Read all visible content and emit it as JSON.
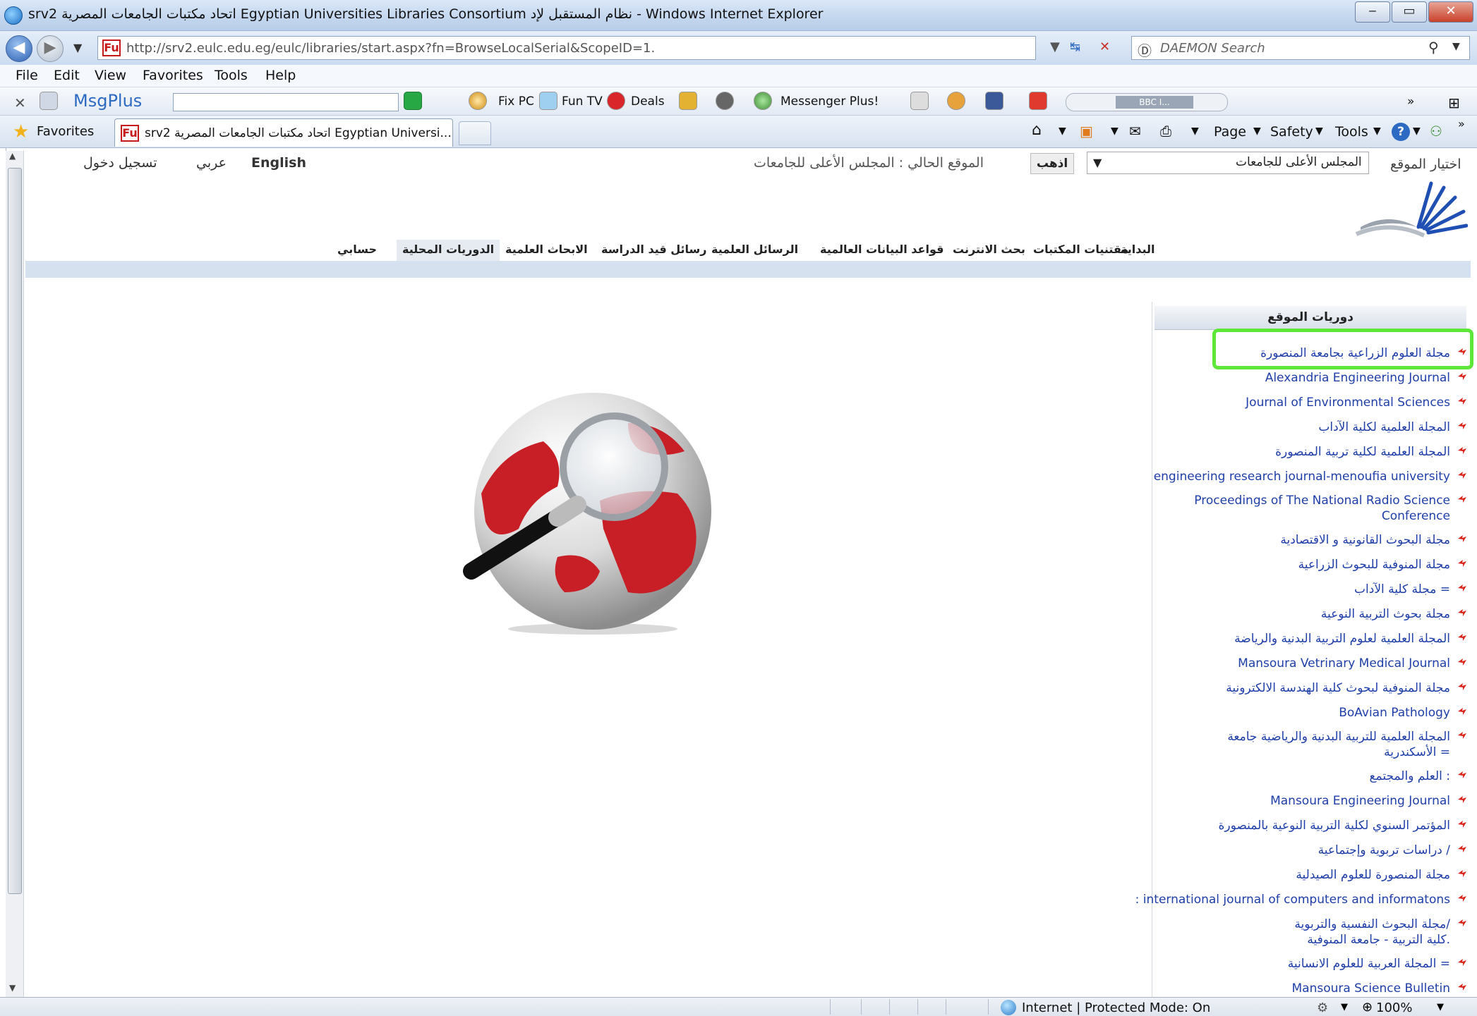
{
  "window": {
    "title": "srv2 اتحاد مكتبات الجامعات المصرية Egyptian Universities Libraries Consortium نظام المستقبل لإد - Windows Internet Explorer",
    "minimize": "‒",
    "maximize": "▭",
    "close": "✕"
  },
  "address": {
    "url": "http://srv2.eulc.edu.eg/eulc/libraries/start.aspx?fn=BrowseLocalSerial&ScopeID=1.",
    "fu_badge": "Fu",
    "search_placeholder": "DAEMON Search"
  },
  "menu": [
    "File",
    "Edit",
    "View",
    "Favorites",
    "Tools",
    "Help"
  ],
  "toolbar": {
    "msgplus": "MsgPlus",
    "fixpc": "Fix PC",
    "funtv": "Fun TV",
    "deals": "Deals",
    "messenger": "Messenger Plus!",
    "radio": "BBC I...",
    "overflow": "»"
  },
  "favorites": {
    "label": "Favorites",
    "tab_title": "srv2 اتحاد مكتبات الجامعات المصرية Egyptian Universi...",
    "page": "Page",
    "safety": "Safety",
    "tools": "Tools"
  },
  "site": {
    "lang_en": "English",
    "lang_ar": "عربي",
    "login": "تسجيل دخول",
    "current_location": "الموقع الحالي : المجلس الأعلى للجامعات",
    "go": "اذهب",
    "site_select_value": "المجلس الأعلى للجامعات",
    "site_select_label": "اختيار الموقع",
    "nav": [
      "البداية",
      "مقتنيات المكتبات",
      "بحث الانترنت",
      "قواعد البيانات العالمية",
      "الرسائل العلمية",
      "رسائل قيد الدراسة",
      "الابحاث العلمية",
      "الدوريات المحلية",
      "حسابي"
    ]
  },
  "panel": {
    "title": "دوريات الموقع",
    "journals": [
      "مجلة العلوم الزراعية بجامعة المنصورة",
      "Alexandria Engineering Journal",
      "Journal of Environmental Sciences",
      "المجلة العلمية لكلية الآداب",
      "المجلة العلمية لكلية تربية المنصورة",
      "engineering research journal-menoufia university",
      "Proceedings of The National Radio Science",
      "Conference",
      "مجلة البحوث القانونية و الاقتصادية",
      "مجلة المنوفية للبحوث الزراعية",
      "مجلة كلية الآداب =",
      "مجلة بحوث التربية النوعية",
      "المجلة العلمية لعلوم التربية البدنية والرياضة",
      "Mansoura Vetrinary Medical Journal",
      "مجلة المنوفية لبحوث كلية الهندسة الالكترونية",
      "BoAvian Pathology",
      "المجلة العلمية للتربية البدنية والرياضية جامعة",
      "الأسكندرية =",
      "العلم والمجتمع :",
      "Mansoura Engineering Journal",
      "المؤتمر السنوي لكلية التربية النوعية بالمنصورة",
      "دراسات تربوية وإجتماعية /",
      "مجلة المنصورة للعلوم الصيدلية",
      ": international journal of computers and informatons",
      "مجلة البحوث النفسية والتربوية/",
      "كلية التربية - جامعة المنوفية.",
      "المجلة العربية للعلوم الانسانية =",
      "Mansoura Science Bulletin"
    ]
  },
  "status": {
    "zone": "Internet | Protected Mode: On",
    "zoom": "100%"
  },
  "colors": {
    "highlight": "#5ee638",
    "link": "#1f3ea8",
    "strip": "#d6e1ef"
  }
}
